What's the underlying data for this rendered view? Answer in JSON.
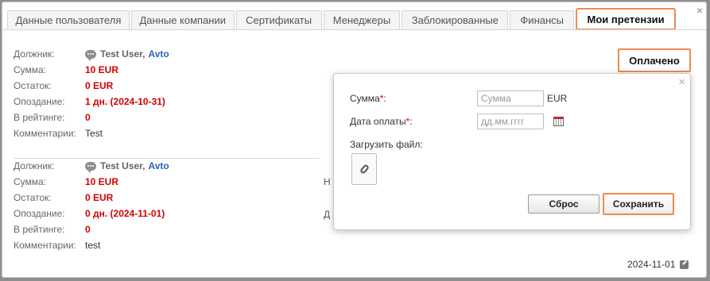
{
  "window": {
    "tabs": [
      {
        "label": "Данные пользователя",
        "active": false
      },
      {
        "label": "Данные компании",
        "active": false
      },
      {
        "label": "Сертификаты",
        "active": false
      },
      {
        "label": "Менеджеры",
        "active": false
      },
      {
        "label": "Заблокированные",
        "active": false
      },
      {
        "label": "Финансы",
        "active": false
      },
      {
        "label": "Мои претензии",
        "active": true
      }
    ]
  },
  "claims": [
    {
      "labels": {
        "debtor": "Должник:",
        "sum": "Сумма:",
        "rest": "Остаток:",
        "delay": "Опоздание:",
        "rating": "В рейтинге:",
        "comment": "Комментарии:"
      },
      "user": "Test User,",
      "company": "Avto",
      "sum": "10 EUR",
      "rest": "0 EUR",
      "delay": "1 дн. (2024-10-31)",
      "rating": "0",
      "comment": "Test"
    },
    {
      "labels": {
        "debtor": "Должник:",
        "sum": "Сумма:",
        "rest": "Остаток:",
        "delay": "Опоздание:",
        "rating": "В рейтинге:",
        "comment": "Комментарии:"
      },
      "user": "Test User,",
      "company": "Avto",
      "sum": "10 EUR",
      "rest": "0 EUR",
      "delay": "0 дн. (2024-11-01)",
      "rating": "0",
      "comment": "test"
    }
  ],
  "paid_button": "Оплачено",
  "bottom_date": "2024-11-01",
  "popup": {
    "sum_label": "Сумма",
    "sum_placeholder": "Сумма",
    "currency": "EUR",
    "date_label": "Дата оплаты",
    "date_placeholder": "дд.мм.гггг",
    "required_mark": "*",
    "colon": ":",
    "upload_label": "Загрузить файл:",
    "reset_button": "Сброс",
    "save_button": "Сохранить"
  },
  "colors": {
    "accent_outline": "#f08a4b",
    "money_red": "#d40000",
    "company_blue": "#2a62b8"
  }
}
